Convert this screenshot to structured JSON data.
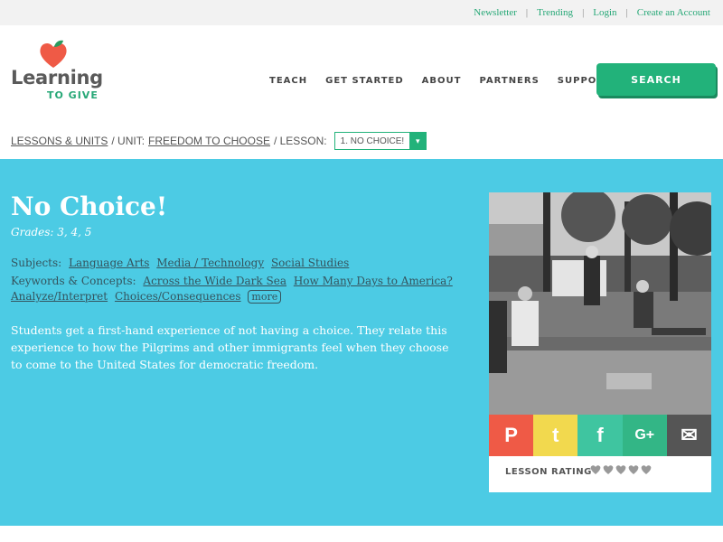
{
  "toplinks": {
    "newsletter": "Newsletter",
    "trending": "Trending",
    "login": "Login",
    "create": "Create an Account"
  },
  "logo": {
    "word": "Learning",
    "sub": "TO GIVE"
  },
  "nav": {
    "items": [
      "TEACH",
      "GET STARTED",
      "ABOUT",
      "PARTNERS",
      "SUPPORT US"
    ],
    "search": "SEARCH"
  },
  "breadcrumb": {
    "lessons_units": "LESSONS & UNITS",
    "unit_prefix": "/ UNIT:",
    "unit": "FREEDOM TO CHOOSE",
    "lesson_prefix": "/ LESSON:",
    "lesson_selected": "1. NO CHOICE!"
  },
  "lesson": {
    "title": "No Choice!",
    "grades": "Grades: 3, 4, 5",
    "subjects_label": "Subjects:",
    "subjects": [
      "Language Arts",
      "Media / Technology",
      "Social Studies"
    ],
    "keywords_label": "Keywords & Concepts:",
    "keywords": [
      "Across the Wide Dark Sea",
      "How Many Days to America?",
      "Analyze/Interpret",
      "Choices/Consequences"
    ],
    "more": "more",
    "description": "Students get a first-hand experience of not having a choice. They relate this experience to how the Pilgrims and other immigrants feel when they choose to come to the United States for democratic freedom."
  },
  "card": {
    "share": [
      {
        "name": "pinterest",
        "glyph": "P",
        "color": "#ef5a46"
      },
      {
        "name": "twitter",
        "glyph": "t",
        "color": "#f2d94e"
      },
      {
        "name": "facebook",
        "glyph": "f",
        "color": "#3fc5a0"
      },
      {
        "name": "google-plus",
        "glyph": "G+",
        "color": "#33b686"
      },
      {
        "name": "email",
        "glyph": "✉",
        "color": "#555555"
      }
    ],
    "rating_label": "LESSON RATING",
    "rating_value": 0,
    "rating_max": 5
  },
  "colors": {
    "accent": "#22b27a",
    "hero": "#4ccbe4"
  }
}
